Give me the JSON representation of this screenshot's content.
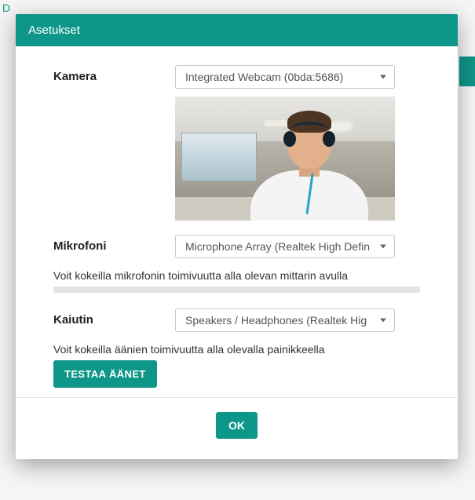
{
  "background": {
    "letter": "D"
  },
  "modal": {
    "title": "Asetukset",
    "camera": {
      "label": "Kamera",
      "selected": "Integrated Webcam (0bda:5686)"
    },
    "microphone": {
      "label": "Mikrofoni",
      "selected": "Microphone Array (Realtek High Defin",
      "info": "Voit kokeilla mikrofonin toimivuutta alla olevan mittarin avulla"
    },
    "speaker": {
      "label": "Kaiutin",
      "selected": "Speakers / Headphones (Realtek Hig",
      "info": "Voit kokeilla äänien toimivuutta alla olevalla painikkeella",
      "test_button": "TESTAA ÄÄNET"
    },
    "ok_button": "OK"
  },
  "colors": {
    "accent": "#0e9688"
  }
}
